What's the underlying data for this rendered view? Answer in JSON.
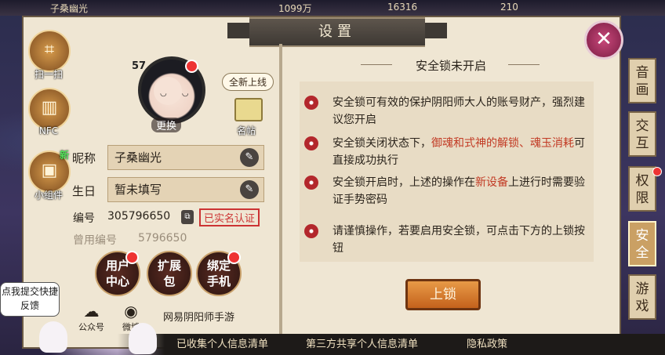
{
  "topbar": {
    "player_name": "子桑幽光",
    "currency_1": "1099万",
    "currency_2": "16316",
    "currency_3": "210"
  },
  "dialog": {
    "title": "设置",
    "close_icon": "close-x-icon"
  },
  "side_buttons": [
    {
      "label": "扫一扫",
      "icon": "scan-icon"
    },
    {
      "label": "NFC",
      "icon": "nfc-icon"
    },
    {
      "label": "小组件",
      "icon": "widget-icon",
      "badge": "新"
    }
  ],
  "profile": {
    "level": "57",
    "change_label": "更换",
    "new_bubble": "全新上线",
    "card_label": "名帖",
    "nickname_label": "昵称",
    "nickname_value": "子桑幽光",
    "birthday_label": "生日",
    "birthday_value": "暂未填写",
    "id_label": "编号",
    "id_value": "305796650",
    "verified_label": "已实名认证",
    "old_id_label": "曾用编号",
    "old_id_value": "5796650"
  },
  "action_buttons": [
    {
      "label": "用户中心"
    },
    {
      "label": "扩展包"
    },
    {
      "label": "绑定手机"
    }
  ],
  "social": {
    "wechat_label": "公众号",
    "weibo_label": "微博",
    "netease_label": "网易阴阳师手游"
  },
  "security": {
    "title": "安全锁未开启",
    "rules": [
      {
        "text": "安全锁可有效的保护阴阳师大人的账号财产，强烈建议您开启"
      },
      {
        "pre": "安全锁关闭状态下，",
        "hl": "御魂和式神的解锁、魂玉消耗",
        "post": "可直接成功执行"
      },
      {
        "pre": "安全锁开启时，上述的操作在",
        "hl": "新设备",
        "post": "上进行时需要验证手势密码"
      },
      {
        "text": "请谨慎操作，若要启用安全锁，可点击下方的上锁按钮"
      }
    ],
    "lock_button": "上锁"
  },
  "tabs": [
    {
      "label": "音画"
    },
    {
      "label": "交互"
    },
    {
      "label": "权限"
    },
    {
      "label": "安全"
    },
    {
      "label": "游戏"
    }
  ],
  "feedback_label": "点我提交快捷反馈",
  "bottom_links": [
    "已收集个人信息清单",
    "第三方共享个人信息清单",
    "隐私政策"
  ]
}
